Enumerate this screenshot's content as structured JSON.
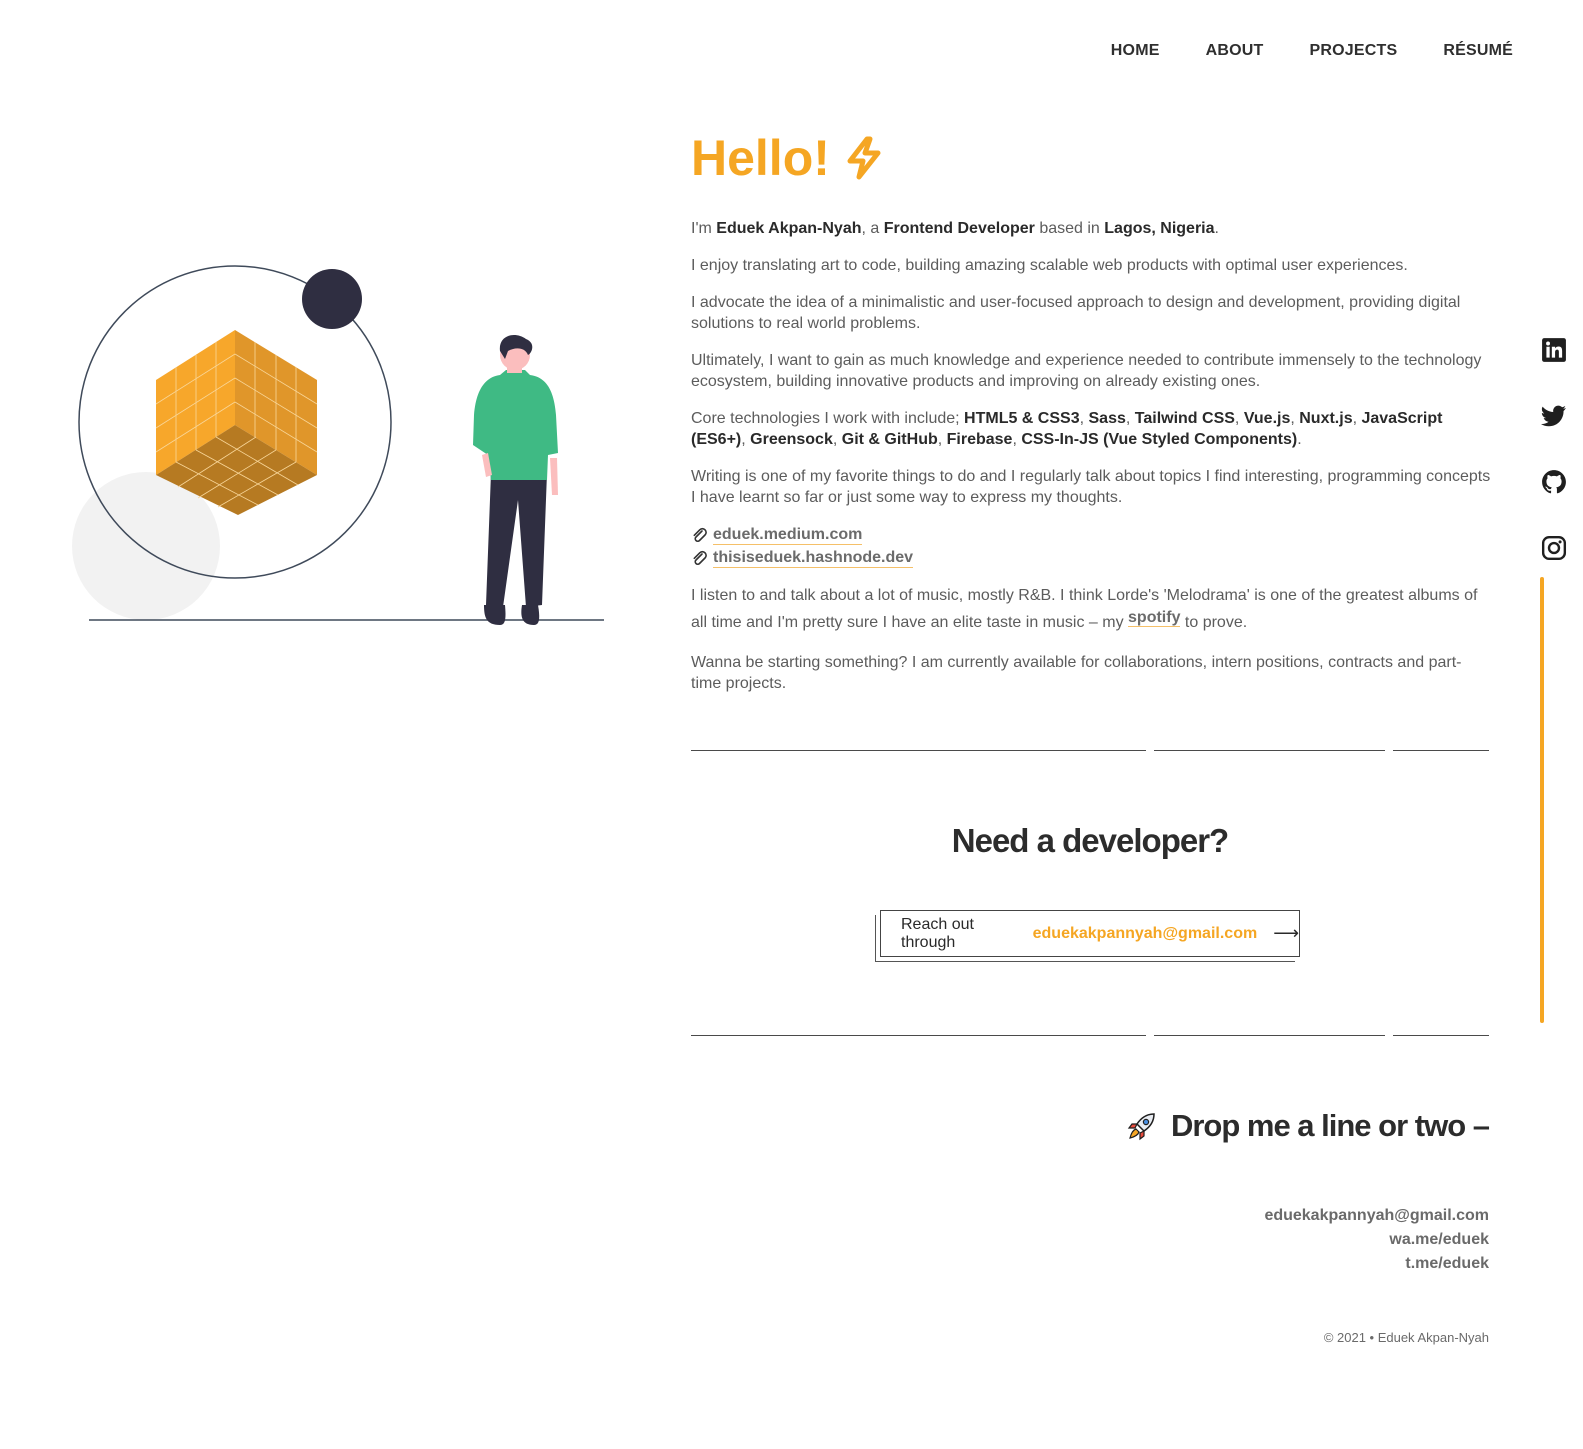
{
  "nav": {
    "home": "HOME",
    "about": "ABOUT",
    "projects": "PROJECTS",
    "resume": "RÉSUMÉ"
  },
  "social": {
    "icons": [
      "linkedin-icon",
      "twitter-icon",
      "github-icon",
      "instagram-icon"
    ]
  },
  "hero": {
    "greeting": "Hello!",
    "greeting_icon": "lightning-bolt-icon"
  },
  "intro": {
    "p1_a": "I'm ",
    "p1_name": "Eduek Akpan-Nyah",
    "p1_b": ", a ",
    "p1_role": "Frontend Developer",
    "p1_c": " based in ",
    "p1_location": "Lagos, Nigeria",
    "p1_d": ".",
    "p2": "I enjoy translating art to code, building amazing scalable web products with optimal user experiences.",
    "p3": "I advocate the idea of a minimalistic and user-focused approach to design and development, providing digital solutions to real world problems.",
    "p4": "Ultimately, I want to gain as much knowledge and experience needed to contribute immensely to the technology ecosystem, building innovative products and improving on already existing ones.",
    "p5_prefix": "Core technologies I work with include; ",
    "technologies": [
      "HTML5 & CSS3",
      "Sass",
      "Tailwind CSS",
      "Vue.js",
      "Nuxt.js",
      "JavaScript (ES6+)",
      "Greensock",
      "Git & GitHub",
      "Firebase",
      "CSS-In-JS (Vue Styled Components)"
    ],
    "p6": "Writing is one of my favorite things to do and I regularly talk about topics I find interesting, programming concepts I have learnt so far or just some way to express my thoughts.",
    "links": [
      "eduek.medium.com",
      "thisiseduek.hashnode.dev"
    ],
    "p7_a": "I listen to and talk about a lot of music, mostly R&B. I think Lorde's 'Melodrama' is one of the greatest albums of all time and I'm pretty sure I have an elite taste in music – my ",
    "p7_link": "spotify",
    "p7_b": " to prove.",
    "p8": "Wanna be starting something? I am currently available for collaborations, intern positions, contracts and part-time projects."
  },
  "cta": {
    "title": "Need a developer?",
    "button_prefix": "Reach out through",
    "button_email": "eduekakpannyah@gmail.com",
    "button_arrow": "⟶"
  },
  "contact": {
    "title": "Drop me a line or two –",
    "title_icon": "rocket-icon",
    "email": "eduekakpannyah@gmail.com",
    "whatsapp": "wa.me/eduek",
    "telegram": "t.me/eduek"
  },
  "footer": {
    "copyright": "© 2021 • Eduek Akpan-Nyah"
  },
  "colors": {
    "accent": "#f5a623",
    "text": "#5c5c5c",
    "heading": "#2c2c2c",
    "figure_shirt": "#3fba84",
    "figure_pants": "#2f2e41"
  }
}
